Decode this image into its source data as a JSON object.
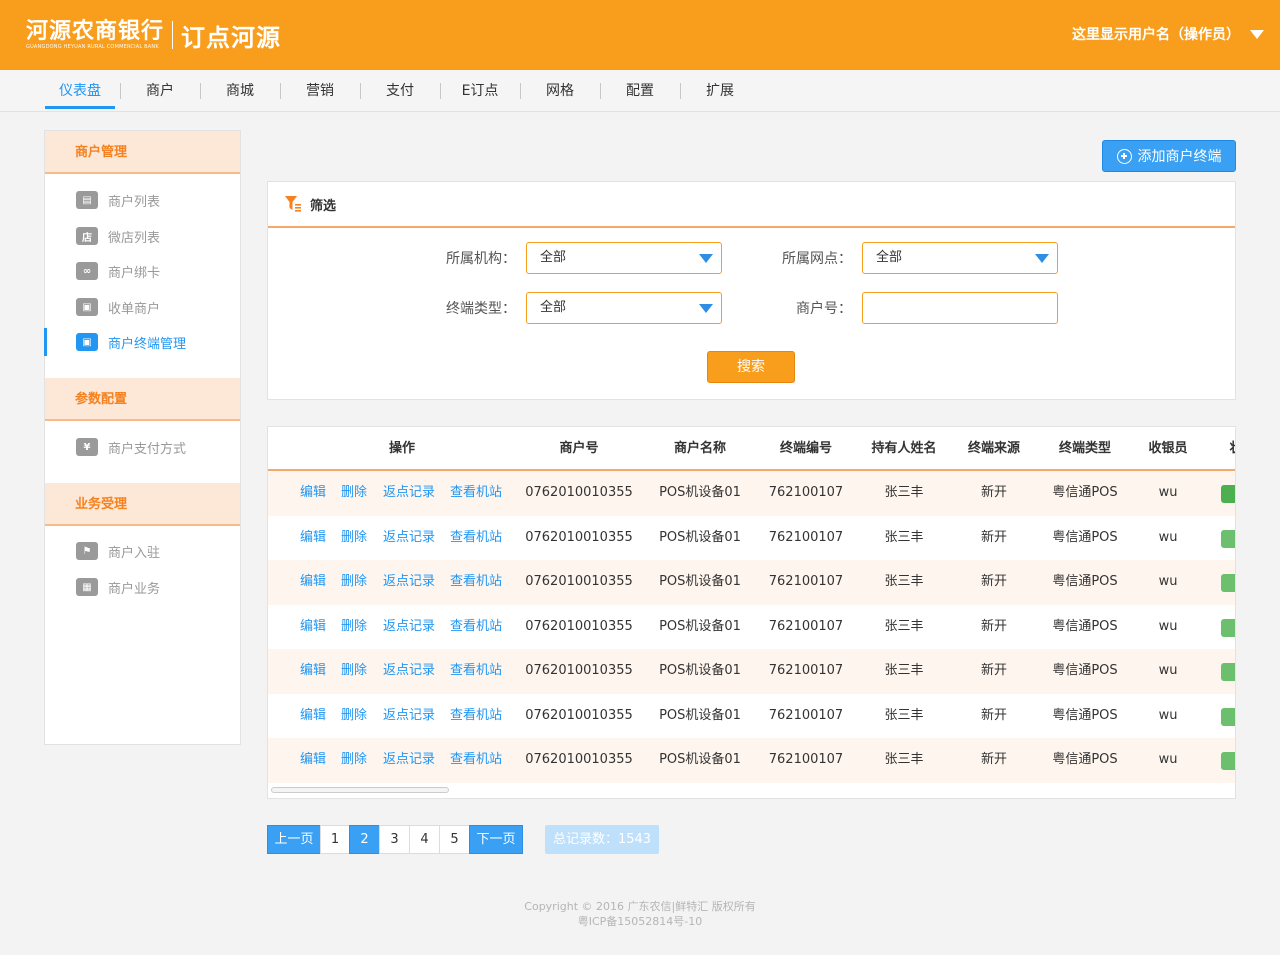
{
  "header": {
    "bank_name": "河源农商银行",
    "bank_name_en": "GUANGDONG HEYUAN RURAL COMMERCIAL BANK",
    "app_name": "订点河源",
    "user_label": "这里显示用户名（操作员）"
  },
  "nav": [
    "仪表盘",
    "商户",
    "商城",
    "营销",
    "支付",
    "E订点",
    "网格",
    "配置",
    "扩展"
  ],
  "sidebar": {
    "groups": [
      {
        "title": "商户管理",
        "items": [
          "商户列表",
          "微店列表",
          "商户绑卡",
          "收单商户",
          "商户终端管理"
        ]
      },
      {
        "title": "参数配置",
        "items": [
          "商户支付方式"
        ]
      },
      {
        "title": "业务受理",
        "items": [
          "商户入驻",
          "商户业务"
        ]
      }
    ],
    "icon_glyphs": [
      "▤",
      "店",
      "∞",
      "▣",
      "▣",
      "¥",
      "⚑",
      "▦"
    ]
  },
  "add_button": "添加商户终端",
  "filter": {
    "title": "筛选",
    "org_label": "所属机构：",
    "org_value": "全部",
    "branch_label": "所属网点：",
    "branch_value": "全部",
    "terminal_type_label": "终端类型：",
    "terminal_type_value": "全部",
    "merchant_no_label": "商户号：",
    "merchant_no_value": "",
    "search_button": "搜索"
  },
  "table": {
    "headers": [
      "操作",
      "商户号",
      "商户名称",
      "终端编号",
      "持有人姓名",
      "终端来源",
      "终端类型",
      "收银员",
      "状"
    ],
    "ops": [
      "编辑",
      "删除",
      "返点记录",
      "查看机站"
    ],
    "rows": [
      [
        "0762010010355",
        "POS机设备01",
        "762100107",
        "张三丰",
        "新开",
        "粤信通POS",
        "wu"
      ],
      [
        "0762010010355",
        "POS机设备01",
        "762100107",
        "张三丰",
        "新开",
        "粤信通POS",
        "wu"
      ],
      [
        "0762010010355",
        "POS机设备01",
        "762100107",
        "张三丰",
        "新开",
        "粤信通POS",
        "wu"
      ],
      [
        "0762010010355",
        "POS机设备01",
        "762100107",
        "张三丰",
        "新开",
        "粤信通POS",
        "wu"
      ],
      [
        "0762010010355",
        "POS机设备01",
        "762100107",
        "张三丰",
        "新开",
        "粤信通POS",
        "wu"
      ],
      [
        "0762010010355",
        "POS机设备01",
        "762100107",
        "张三丰",
        "新开",
        "粤信通POS",
        "wu"
      ],
      [
        "0762010010355",
        "POS机设备01",
        "762100107",
        "张三丰",
        "新开",
        "粤信通POS",
        "wu"
      ]
    ]
  },
  "pagination": {
    "prev": "上一页",
    "pages": [
      "1",
      "2",
      "3",
      "4",
      "5"
    ],
    "current": "2",
    "next": "下一页",
    "total": "总记录数：1543"
  },
  "footer": {
    "copyright": "Copyright © 2016 广东农信|鲜特汇 版权所有",
    "icp": "粤ICP备15052814号-10"
  },
  "colors": {
    "brand": "#f99d1c",
    "accent": "#2196f3",
    "status": "#6cbf6c"
  }
}
